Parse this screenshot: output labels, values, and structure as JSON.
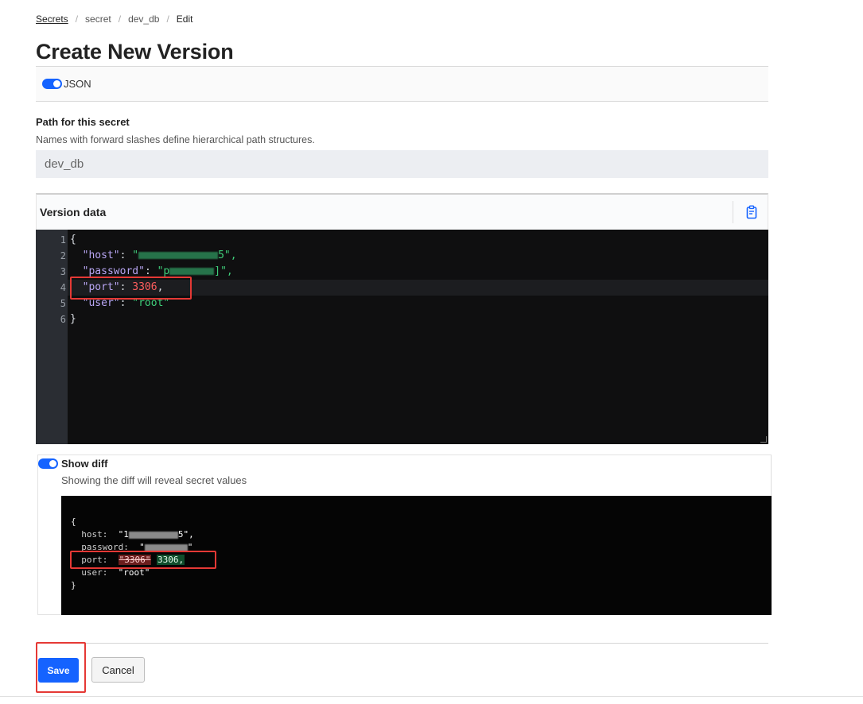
{
  "breadcrumb": {
    "items": [
      {
        "label": "Secrets"
      },
      {
        "label": "secret"
      },
      {
        "label": "dev_db"
      },
      {
        "label": "Edit"
      }
    ],
    "separator": "/"
  },
  "page": {
    "title": "Create New Version"
  },
  "json_toggle": {
    "label": "JSON",
    "on": true
  },
  "path": {
    "label": "Path for this secret",
    "help": "Names with forward slashes define hierarchical path structures.",
    "value": "dev_db"
  },
  "version_data": {
    "title": "Version data",
    "copy_icon": "clipboard-icon",
    "line_numbers": [
      "1",
      "2",
      "3",
      "4",
      "5",
      "6"
    ],
    "lines": {
      "open": "{",
      "host_key": "\"host\"",
      "host_quote_open": "\"",
      "host_tail": "5\",",
      "password_key": "\"password\"",
      "password_value_start": "\"p",
      "password_tail": "]\",",
      "port_key": "\"port\"",
      "port_value": "3306",
      "user_key": "\"user\"",
      "user_value": "\"root\"",
      "close": "}",
      "colon": ": ",
      "comma": ","
    }
  },
  "diff": {
    "toggle_on": true,
    "title": "Show diff",
    "help": "Showing the diff will reveal secret values",
    "lines": {
      "open": "{",
      "host_key": "host:",
      "host_value_start": "\"1",
      "host_value_end": "5\",",
      "password_key": "password:",
      "password_value_start": "\"",
      "password_value_end": "\"",
      "port_key": "port:",
      "port_removed": "\"3306\"",
      "port_added": "3306,",
      "user_key": "user:",
      "user_value": "\"root\"",
      "close": "}"
    }
  },
  "actions": {
    "save_label": "Save",
    "cancel_label": "Cancel"
  },
  "colors": {
    "primary": "#1563ff",
    "highlight_box": "#e53935",
    "editor_bg": "#0f0f10",
    "string": "#3fcf7a",
    "number": "#ff5e5e",
    "key": "#b9a6f4"
  }
}
